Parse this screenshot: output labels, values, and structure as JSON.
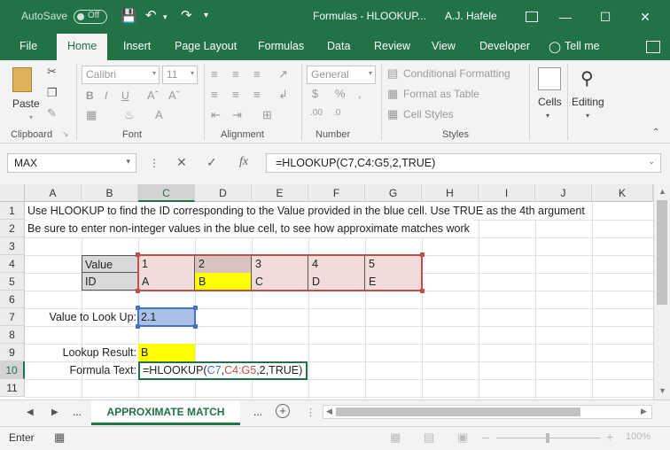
{
  "titlebar": {
    "autosave_label": "AutoSave",
    "autosave_state": "Off",
    "file_title": "Formulas - HLOOKUP...",
    "user": "A.J. Hafele",
    "accent": "#217346"
  },
  "menu": {
    "file": "File",
    "home": "Home",
    "insert": "Insert",
    "page_layout": "Page Layout",
    "formulas": "Formulas",
    "data": "Data",
    "review": "Review",
    "view": "View",
    "developer": "Developer",
    "tell_me": "Tell me"
  },
  "ribbon": {
    "paste": "Paste",
    "clipboard": "Clipboard",
    "font_name": "Calibri",
    "font_size": "11",
    "font_group": "Font",
    "alignment": "Alignment",
    "number_format": "General",
    "number": "Number",
    "conditional_formatting": "Conditional Formatting",
    "format_as_table": "Format as Table",
    "cell_styles": "Cell Styles",
    "styles": "Styles",
    "cells": "Cells",
    "editing": "Editing"
  },
  "formula_bar": {
    "name_box": "MAX",
    "formula": "=HLOOKUP(C7,C4:G5,2,TRUE)"
  },
  "grid": {
    "columns": [
      "A",
      "B",
      "C",
      "D",
      "E",
      "F",
      "G",
      "H",
      "I",
      "J",
      "K"
    ],
    "rows": [
      "1",
      "2",
      "3",
      "4",
      "5",
      "6",
      "7",
      "8",
      "9",
      "10",
      "11"
    ],
    "row1": "Use HLOOKUP to find the ID corresponding to the Value provided in the blue cell.  Use TRUE as the 4th argument",
    "row2": "Be sure to enter non-integer values in the blue cell, to see how approximate matches work",
    "table": {
      "value_label": "Value",
      "id_label": "ID",
      "values": [
        "1",
        "2",
        "3",
        "4",
        "5"
      ],
      "ids": [
        "A",
        "B",
        "C",
        "D",
        "E"
      ]
    },
    "lookup_label": "Value to Look Up:",
    "lookup_value": "2.1",
    "result_label": "Lookup Result:",
    "result_value": "B",
    "formula_text_label": "Formula Text:",
    "formula_text": {
      "p1": "=HLOOKUP(",
      "ref1": "C7",
      "p2": ",",
      "ref2": "C4:G5",
      "p3": ",2,TRUE)"
    }
  },
  "sheets": {
    "more_left": "...",
    "active": "APPROXIMATE MATCH",
    "more_right": "..."
  },
  "status": {
    "mode": "Enter",
    "zoom": "100%"
  }
}
